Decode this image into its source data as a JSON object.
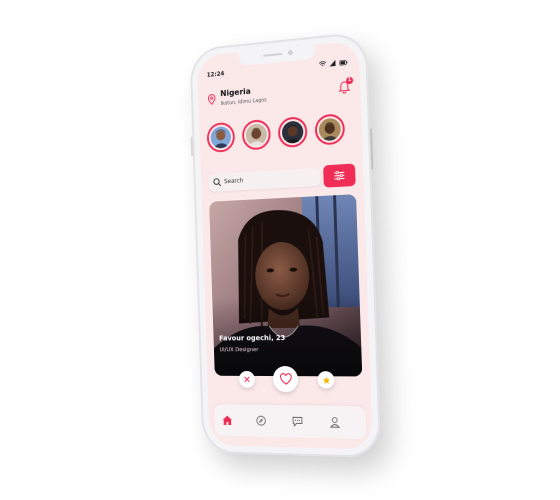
{
  "status_bar": {
    "time": "12:24"
  },
  "header": {
    "country": "Nigeria",
    "area": "Ikotun, Idimu Lagos",
    "notification_count": "1"
  },
  "search": {
    "placeholder": "Search"
  },
  "profile_card": {
    "name": "Favour ogechi, 23",
    "role": "UI/UX Designer"
  },
  "icons": {
    "location": "map-pin-icon",
    "notifications": "bell-icon",
    "search": "magnifier-icon",
    "filter": "sliders-icon",
    "dislike": "close-icon",
    "like": "heart-icon",
    "superlike": "star-icon",
    "nav_home": "home-icon",
    "nav_explore": "compass-icon",
    "nav_messages": "chat-icon",
    "nav_profile": "user-icon"
  },
  "colors": {
    "accent": "#ef2d56",
    "screen_background": "#fbe9ea",
    "star": "#f5b400"
  }
}
